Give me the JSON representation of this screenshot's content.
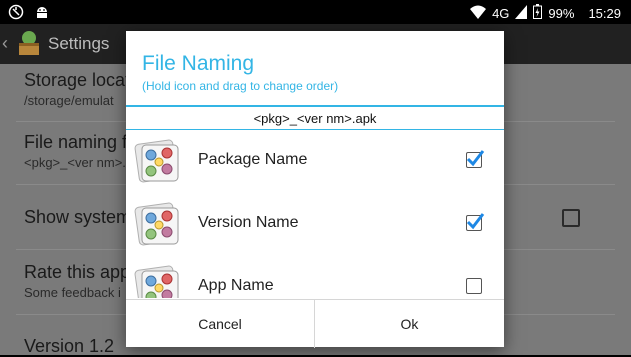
{
  "status_bar": {
    "network": "4G",
    "battery": "99%",
    "time": "15:29"
  },
  "background": {
    "app_title": "Settings",
    "prefs": [
      {
        "title": "Storage locat",
        "summary": "/storage/emulat"
      },
      {
        "title": "File naming f",
        "summary": "<pkg>_<ver nm>."
      },
      {
        "title": "Show system",
        "summary": ""
      },
      {
        "title": "Rate this app",
        "summary": "Some feedback i"
      },
      {
        "title": "Version 1.2",
        "summary": ""
      }
    ]
  },
  "dialog": {
    "title": "File Naming",
    "subtitle": "(Hold icon and drag to change order)",
    "preview": "<pkg>_<ver nm>.apk",
    "items": [
      {
        "label": "Package Name",
        "checked": true
      },
      {
        "label": "Version Name",
        "checked": true
      },
      {
        "label": "App Name",
        "checked": false
      }
    ],
    "cancel_label": "Cancel",
    "ok_label": "Ok"
  },
  "colors": {
    "accent": "#33b5e5",
    "check": "#1e88e5"
  }
}
